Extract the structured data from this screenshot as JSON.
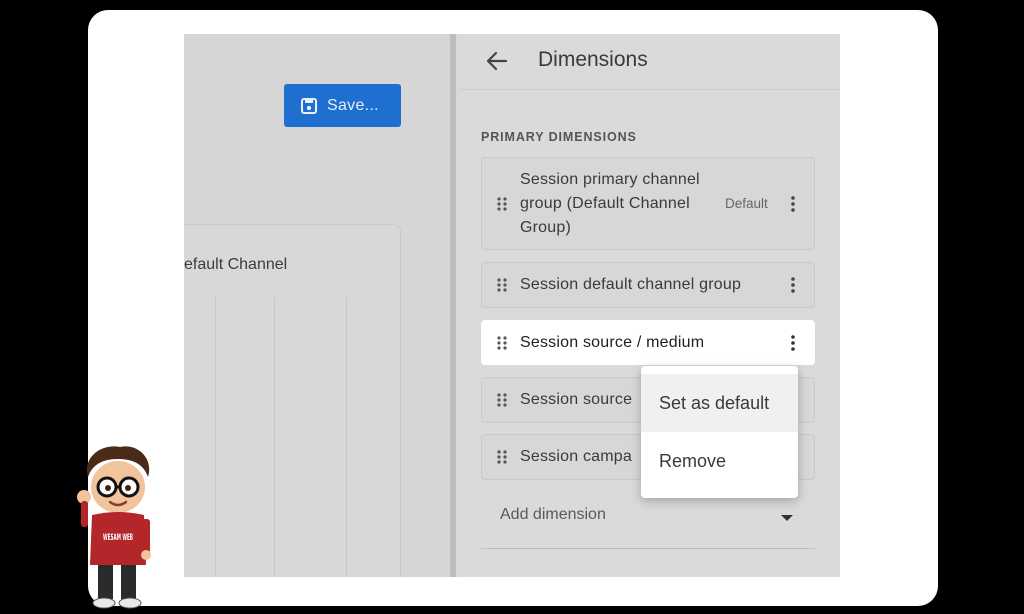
{
  "toolbar": {
    "save_label": "Save..."
  },
  "report_card": {
    "title_fragment": "efault Channel"
  },
  "panel": {
    "title": "Dimensions",
    "section_label": "PRIMARY DIMENSIONS",
    "rows": [
      {
        "label_lines": [
          "Session primary channel",
          "group (Default Channel",
          "Group)"
        ],
        "tag": "Default"
      },
      {
        "label": "Session default channel group"
      },
      {
        "label": "Session source / medium"
      },
      {
        "label": "Session source"
      },
      {
        "label": "Session campa"
      }
    ],
    "add_dimension_label": "Add dimension"
  },
  "menu": {
    "items": [
      "Set as default",
      "Remove"
    ]
  },
  "mascot": {
    "shirt_text": "WESAM WEB"
  },
  "colors": {
    "accent": "#1f6fd1",
    "backdrop": "#000000",
    "frame": "#ffffff"
  },
  "icons": [
    "save-icon",
    "back-arrow-icon",
    "drag-handle-icon",
    "more-vert-icon",
    "dropdown-caret-icon"
  ]
}
